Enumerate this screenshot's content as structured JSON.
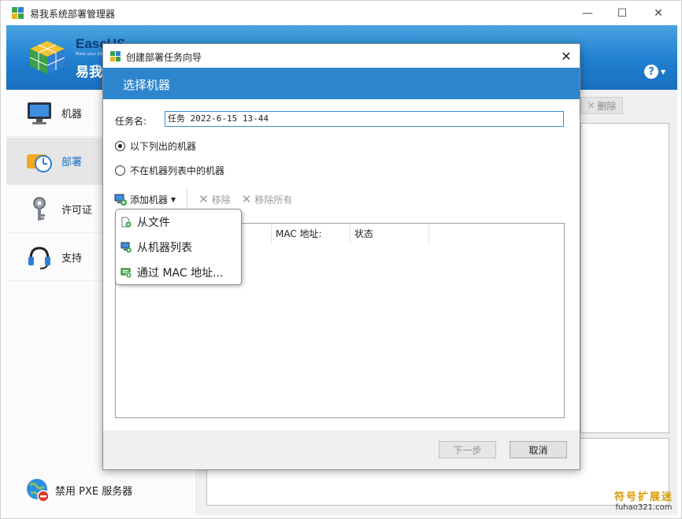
{
  "main_window": {
    "title": "易我系统部署管理器",
    "controls": {
      "minimize": "—",
      "maximize": "☐",
      "close": "✕"
    }
  },
  "banner": {
    "brand": "EaseUS",
    "brand_sub": "Make your life easy",
    "brand_cn": "易我",
    "help_icon": "question-icon"
  },
  "sidebar": {
    "items": [
      {
        "label": "机器",
        "icon": "monitor-icon"
      },
      {
        "label": "部署",
        "icon": "deploy-icon",
        "active": true
      },
      {
        "label": "许可证",
        "icon": "key-icon"
      },
      {
        "label": "支持",
        "icon": "headset-icon"
      }
    ],
    "pxe": {
      "label": "禁用 PXE 服务器",
      "icon": "globe-disable-icon"
    }
  },
  "content": {
    "delete_label": "删除"
  },
  "dialog": {
    "title": "创建部署任务向导",
    "header": "选择机器",
    "task_name_label": "任务名:",
    "task_name_value": "任务 2022-6-15 13-44",
    "radio_listed": "以下列出的机器",
    "radio_not_listed": "不在机器列表中的机器",
    "toolbar": {
      "add": "添加机器",
      "remove": "移除",
      "remove_all": "移除所有"
    },
    "table_headers": [
      "",
      "MAC 地址:",
      "状态"
    ],
    "dropdown": [
      "从文件",
      "从机器列表",
      "通过 MAC 地址..."
    ],
    "next_label": "下一步",
    "cancel_label": "取消"
  },
  "watermark": {
    "line1": "符号扩展迷",
    "line2": "fuhao321.com"
  },
  "colors": {
    "accent": "#2d86cd",
    "banner": "#1f7fd0"
  }
}
